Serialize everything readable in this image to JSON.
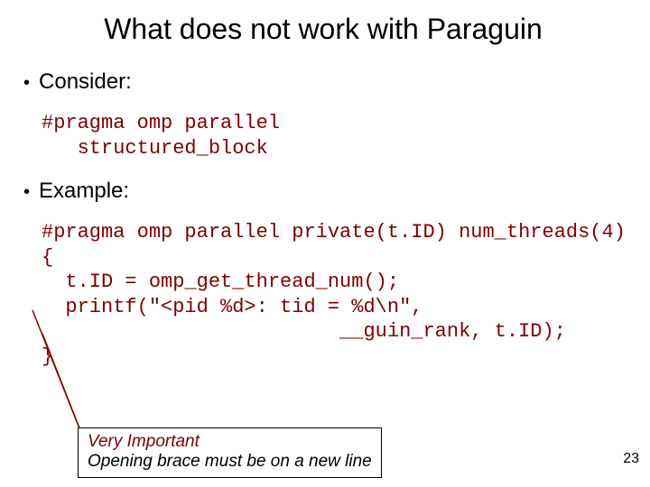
{
  "title": "What does not work with Paraguin",
  "bullets": {
    "consider": "Consider:",
    "example": "Example:"
  },
  "code_block_1": "#pragma omp parallel\n   structured_block",
  "code_block_2": "#pragma omp parallel private(t.ID) num_threads(4)\n{\n  t.ID = omp_get_thread_num();\n  printf(\"<pid %d>: tid = %d\\n\",\n                         __guin_rank, t.ID);\n}",
  "callout": {
    "title": "Very Important",
    "sub": "Opening brace must be on a new line"
  },
  "page_number": "23"
}
